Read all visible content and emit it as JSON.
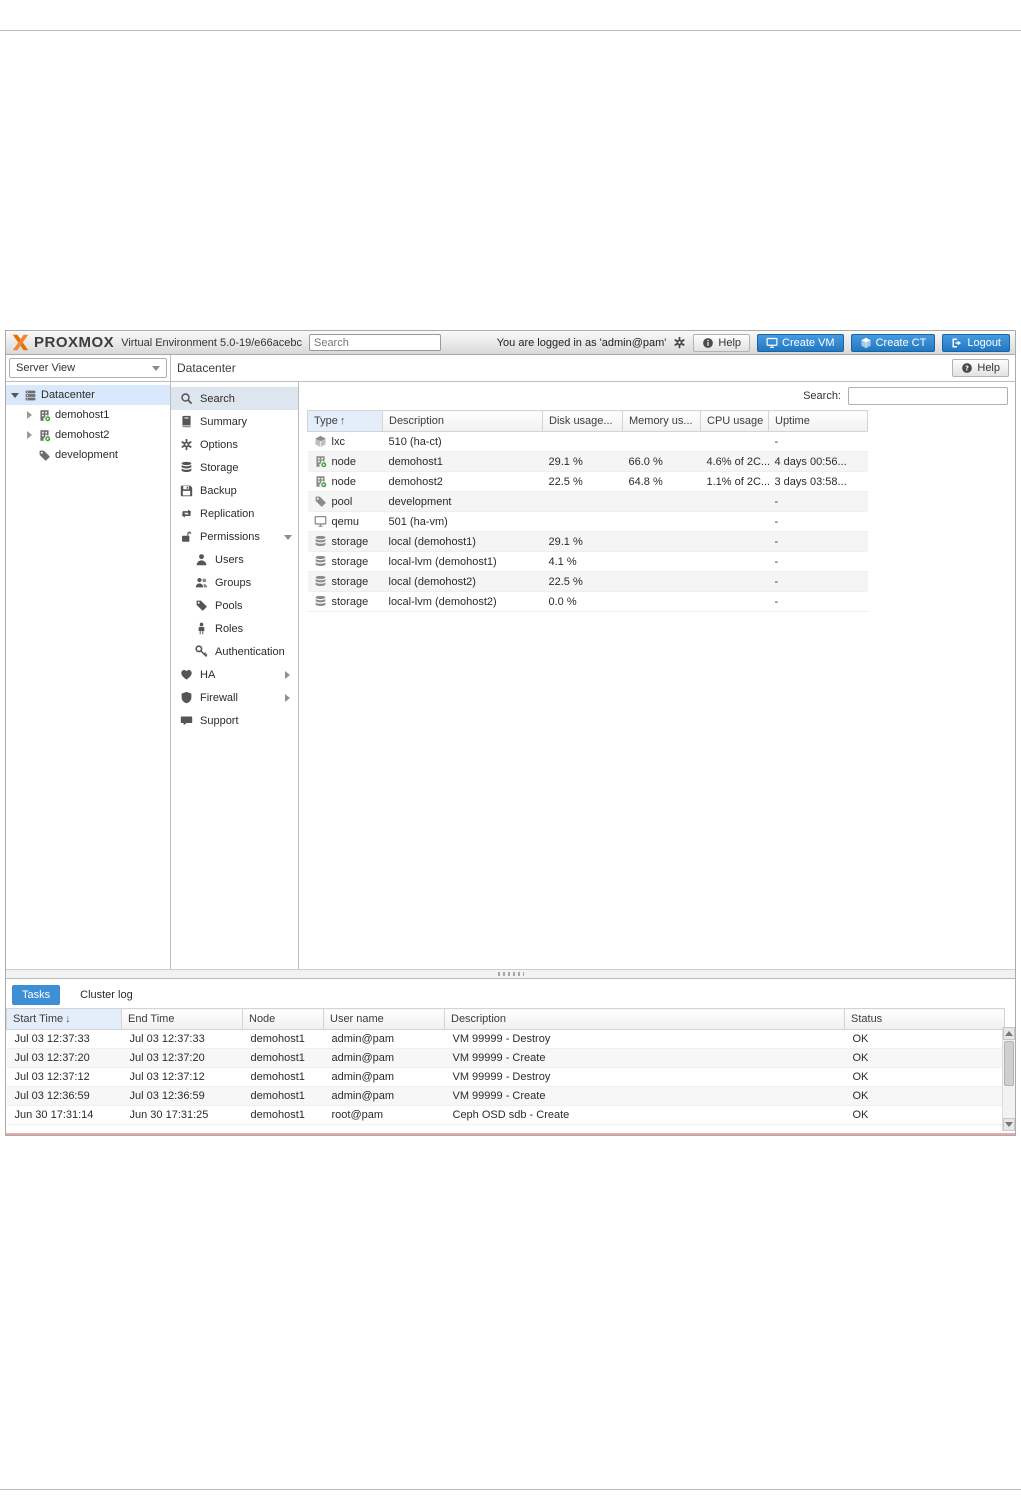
{
  "colors": {
    "brand_orange": "#e57000",
    "button_blue": "#2278c1",
    "tab_selected_blue": "#3d8fd6",
    "selection_blue": "#d9e8fb",
    "node_running_green": "#35a835"
  },
  "header": {
    "logo": "PROXMOX",
    "version": "Virtual Environment 5.0-19/e66acebc",
    "search_placeholder": "Search",
    "login_text": "You are logged in as 'admin@pam'",
    "help": "Help",
    "create_vm": "Create VM",
    "create_ct": "Create CT",
    "logout": "Logout",
    "icons": {
      "settings": "gear-icon",
      "help": "info-icon",
      "create_vm": "monitor-icon",
      "create_ct": "cube-icon",
      "logout": "logout-icon"
    }
  },
  "sidebar": {
    "view": "Server View",
    "tree": [
      {
        "label": "Datacenter",
        "icon": "datacenter-icon",
        "level": 0,
        "expander": "open",
        "selected": true
      },
      {
        "label": "demohost1",
        "icon": "node-icon",
        "level": 1,
        "expander": "closed"
      },
      {
        "label": "demohost2",
        "icon": "node-icon",
        "level": 1,
        "expander": "closed"
      },
      {
        "label": "development",
        "icon": "pool-icon",
        "level": 1
      }
    ]
  },
  "panel": {
    "title": "Datacenter",
    "help": "Help",
    "help_icon": "question-icon",
    "search_label": "Search:",
    "search_value": "",
    "nav": [
      {
        "label": "Search",
        "icon": "search-icon",
        "selected": true
      },
      {
        "label": "Summary",
        "icon": "book-icon"
      },
      {
        "label": "Options",
        "icon": "gear-icon"
      },
      {
        "label": "Storage",
        "icon": "storage-icon"
      },
      {
        "label": "Backup",
        "icon": "backup-icon"
      },
      {
        "label": "Replication",
        "icon": "replication-icon"
      },
      {
        "label": "Permissions",
        "icon": "permissions-icon",
        "arrow": "down"
      },
      {
        "label": "Users",
        "icon": "user-icon",
        "indent": true
      },
      {
        "label": "Groups",
        "icon": "groups-icon",
        "indent": true
      },
      {
        "label": "Pools",
        "icon": "pools-icon",
        "indent": true
      },
      {
        "label": "Roles",
        "icon": "roles-icon",
        "indent": true
      },
      {
        "label": "Authentication",
        "icon": "key-icon",
        "indent": true
      },
      {
        "label": "HA",
        "icon": "ha-icon",
        "arrow": "right"
      },
      {
        "label": "Firewall",
        "icon": "firewall-icon",
        "arrow": "right"
      },
      {
        "label": "Support",
        "icon": "support-icon"
      }
    ]
  },
  "resources": {
    "columns": {
      "type": "Type",
      "description": "Description",
      "disk": "Disk usage...",
      "memory": "Memory us...",
      "cpu": "CPU usage",
      "uptime": "Uptime"
    },
    "sort_arrow": "↑",
    "rows": [
      {
        "icon": "lxc-icon",
        "type": "lxc",
        "description": "510 (ha-ct)",
        "disk": "",
        "memory": "",
        "cpu": "",
        "uptime": "-"
      },
      {
        "icon": "node-icon",
        "type": "node",
        "description": "demohost1",
        "disk": "29.1 %",
        "memory": "66.0 %",
        "cpu": "4.6% of 2C...",
        "uptime": "4 days 00:56..."
      },
      {
        "icon": "node-icon",
        "type": "node",
        "description": "demohost2",
        "disk": "22.5 %",
        "memory": "64.8 %",
        "cpu": "1.1% of 2C...",
        "uptime": "3 days 03:58..."
      },
      {
        "icon": "pool-icon",
        "type": "pool",
        "description": "development",
        "disk": "",
        "memory": "",
        "cpu": "",
        "uptime": "-"
      },
      {
        "icon": "qemu-icon",
        "type": "qemu",
        "description": "501 (ha-vm)",
        "disk": "",
        "memory": "",
        "cpu": "",
        "uptime": "-"
      },
      {
        "icon": "storage-icon",
        "type": "storage",
        "description": "local (demohost1)",
        "disk": "29.1 %",
        "memory": "",
        "cpu": "",
        "uptime": "-"
      },
      {
        "icon": "storage-icon",
        "type": "storage",
        "description": "local-lvm (demohost1)",
        "disk": "4.1 %",
        "memory": "",
        "cpu": "",
        "uptime": "-"
      },
      {
        "icon": "storage-icon",
        "type": "storage",
        "description": "local (demohost2)",
        "disk": "22.5 %",
        "memory": "",
        "cpu": "",
        "uptime": "-"
      },
      {
        "icon": "storage-icon",
        "type": "storage",
        "description": "local-lvm (demohost2)",
        "disk": "0.0 %",
        "memory": "",
        "cpu": "",
        "uptime": "-"
      }
    ]
  },
  "tasks": {
    "tabs": [
      {
        "label": "Tasks",
        "selected": true
      },
      {
        "label": "Cluster log"
      }
    ],
    "columns": {
      "start": "Start Time",
      "end": "End Time",
      "node": "Node",
      "user": "User name",
      "description": "Description",
      "status": "Status"
    },
    "sort_arrow": "↓",
    "rows": [
      {
        "start": "Jul 03 12:37:33",
        "end": "Jul 03 12:37:33",
        "node": "demohost1",
        "user": "admin@pam",
        "description": "VM 99999 - Destroy",
        "status": "OK"
      },
      {
        "start": "Jul 03 12:37:20",
        "end": "Jul 03 12:37:20",
        "node": "demohost1",
        "user": "admin@pam",
        "description": "VM 99999 - Create",
        "status": "OK"
      },
      {
        "start": "Jul 03 12:37:12",
        "end": "Jul 03 12:37:12",
        "node": "demohost1",
        "user": "admin@pam",
        "description": "VM 99999 - Destroy",
        "status": "OK"
      },
      {
        "start": "Jul 03 12:36:59",
        "end": "Jul 03 12:36:59",
        "node": "demohost1",
        "user": "admin@pam",
        "description": "VM 99999 - Create",
        "status": "OK"
      },
      {
        "start": "Jun 30 17:31:14",
        "end": "Jun 30 17:31:25",
        "node": "demohost1",
        "user": "root@pam",
        "description": "Ceph OSD sdb - Create",
        "status": "OK"
      }
    ]
  }
}
